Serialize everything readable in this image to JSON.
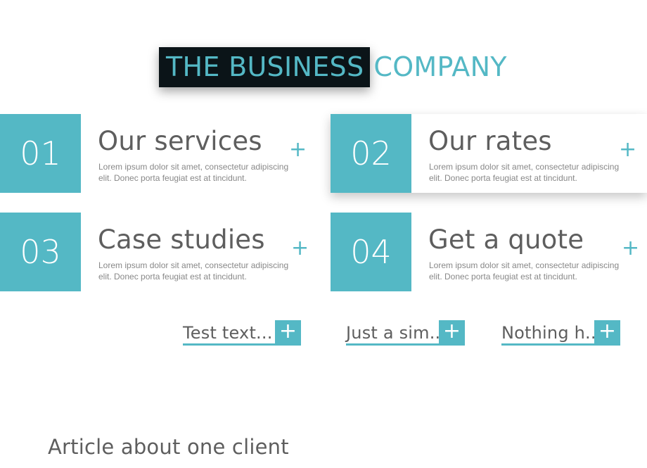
{
  "brand": {
    "part1": "THE BUSINESS",
    "part2": "COMPANY"
  },
  "cards": [
    {
      "number": "01",
      "title": "Our services",
      "description": "Lorem ipsum dolor sit amet, consectetur adipiscing elit. Donec porta feugiat est at tincidunt.",
      "plus": "+"
    },
    {
      "number": "02",
      "title": "Our rates",
      "description": "Lorem ipsum dolor sit amet, consectetur adipiscing elit. Donec porta feugiat est at tincidunt.",
      "plus": "+"
    },
    {
      "number": "03",
      "title": "Case studies",
      "description": "Lorem ipsum dolor sit amet, consectetur adipiscing elit. Donec porta feugiat est at tincidunt.",
      "plus": "+"
    },
    {
      "number": "04",
      "title": "Get a quote",
      "description": "Lorem ipsum dolor sit amet, consectetur adipiscing elit. Donec porta feugiat est at tincidunt.",
      "plus": "+"
    }
  ],
  "links": [
    {
      "label": "Test text...",
      "plus": "+"
    },
    {
      "label": "Just a sim...",
      "plus": "+"
    },
    {
      "label": "Nothing h...",
      "plus": "+"
    }
  ],
  "article": {
    "title": "Article about one client"
  },
  "colors": {
    "accent": "#54b8c5",
    "dark": "#0b1418",
    "text": "#5e5e5e",
    "muted": "#888888"
  }
}
